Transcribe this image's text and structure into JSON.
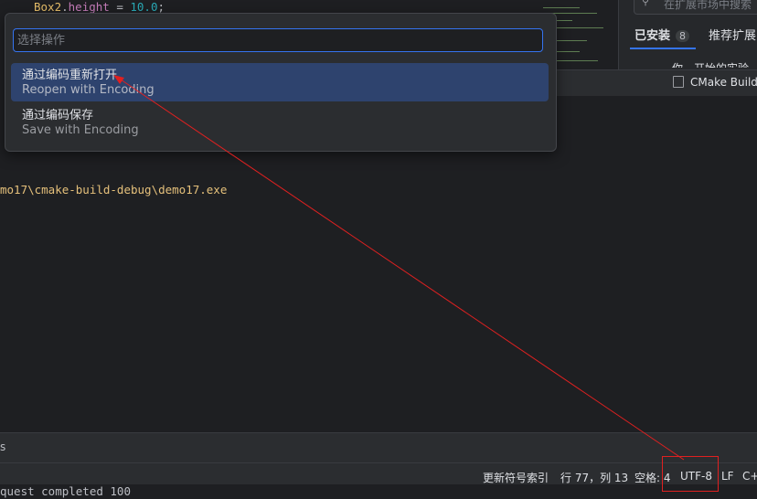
{
  "editor": {
    "code_obj": "Box2",
    "code_prop": "height",
    "code_rest": " = ",
    "code_num": "10.0",
    "code_end": ";"
  },
  "extensions": {
    "search_placeholder": "在扩展市场中搜索",
    "tab_installed": "已安装",
    "tab_installed_count": "8",
    "tab_recommended": "推荐扩展",
    "cut_text": "你一开始的实验"
  },
  "toolstrip": {
    "cmake_label": "CMake Build To"
  },
  "terminal": {
    "exe_path": "mo17\\cmake-build-debug\\demo17.exe",
    "bottom_line": "quest completed 100"
  },
  "midbar": {
    "label": "s"
  },
  "popup": {
    "placeholder": "选择操作",
    "items": [
      {
        "zh": "通过编码重新打开",
        "en": "Reopen with Encoding",
        "selected": true
      },
      {
        "zh": "通过编码保存",
        "en": "Save with Encoding",
        "selected": false
      }
    ]
  },
  "statusbar": {
    "index_text": "更新符号索引",
    "position": "行 77，列 13",
    "indent": "空格: 4",
    "encoding": "UTF-8",
    "line_ending": "LF",
    "language": "C++"
  },
  "colors": {
    "accent": "#3574f0",
    "annotation": "#e02020",
    "selection": "#2e436e"
  },
  "icons": [
    "search-icon",
    "cmake-file-icon"
  ]
}
